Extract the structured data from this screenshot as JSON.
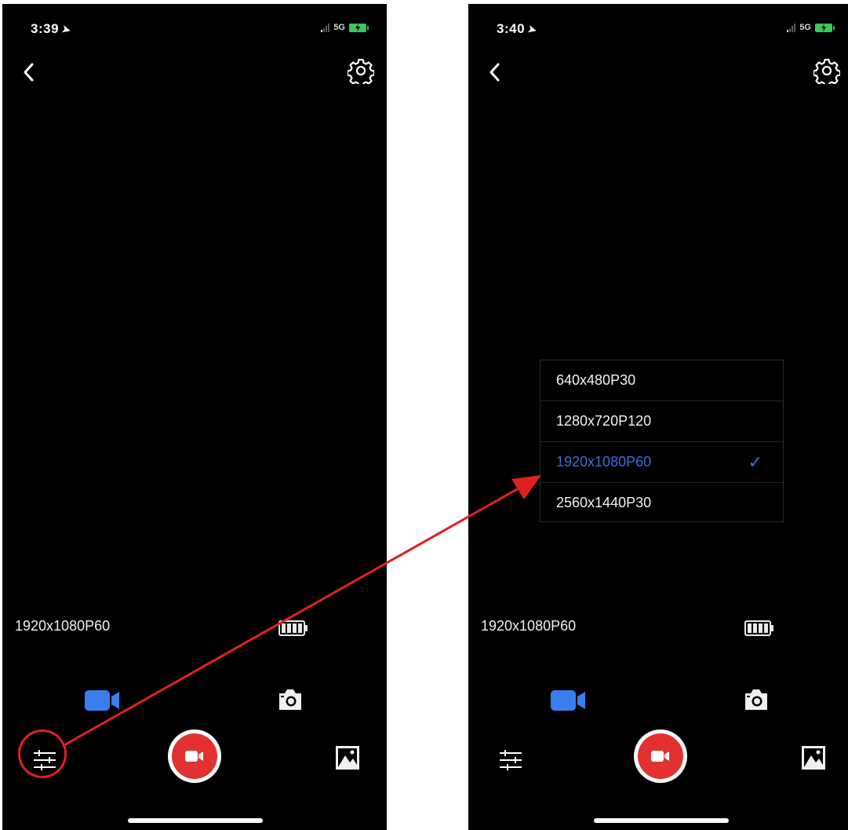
{
  "left_screen": {
    "status": {
      "time": "3:39",
      "network": "5G"
    },
    "resolution": "1920x1080P60"
  },
  "right_screen": {
    "status": {
      "time": "3:40",
      "network": "5G"
    },
    "resolution": "1920x1080P60",
    "dropdown": {
      "options": [
        {
          "label": "640x480P30",
          "selected": false
        },
        {
          "label": "1280x720P120",
          "selected": false
        },
        {
          "label": "1920x1080P60",
          "selected": true
        },
        {
          "label": "2560x1440P30",
          "selected": false
        }
      ],
      "check_glyph": "✓"
    }
  },
  "icons": {
    "back": "chevron-left-icon",
    "settings": "gear-icon",
    "video_mode": "video-camera-icon",
    "photo_mode": "camera-icon",
    "adjust": "sliders-icon",
    "record": "record-video-icon",
    "gallery": "image-gallery-icon",
    "camera_battery": "battery-full-icon"
  },
  "colors": {
    "background": "#000000",
    "accent_blue": "#3a7ff0",
    "record_red": "#e23130",
    "annotation_red": "#e02020",
    "selected_text": "#3a6fd8"
  }
}
